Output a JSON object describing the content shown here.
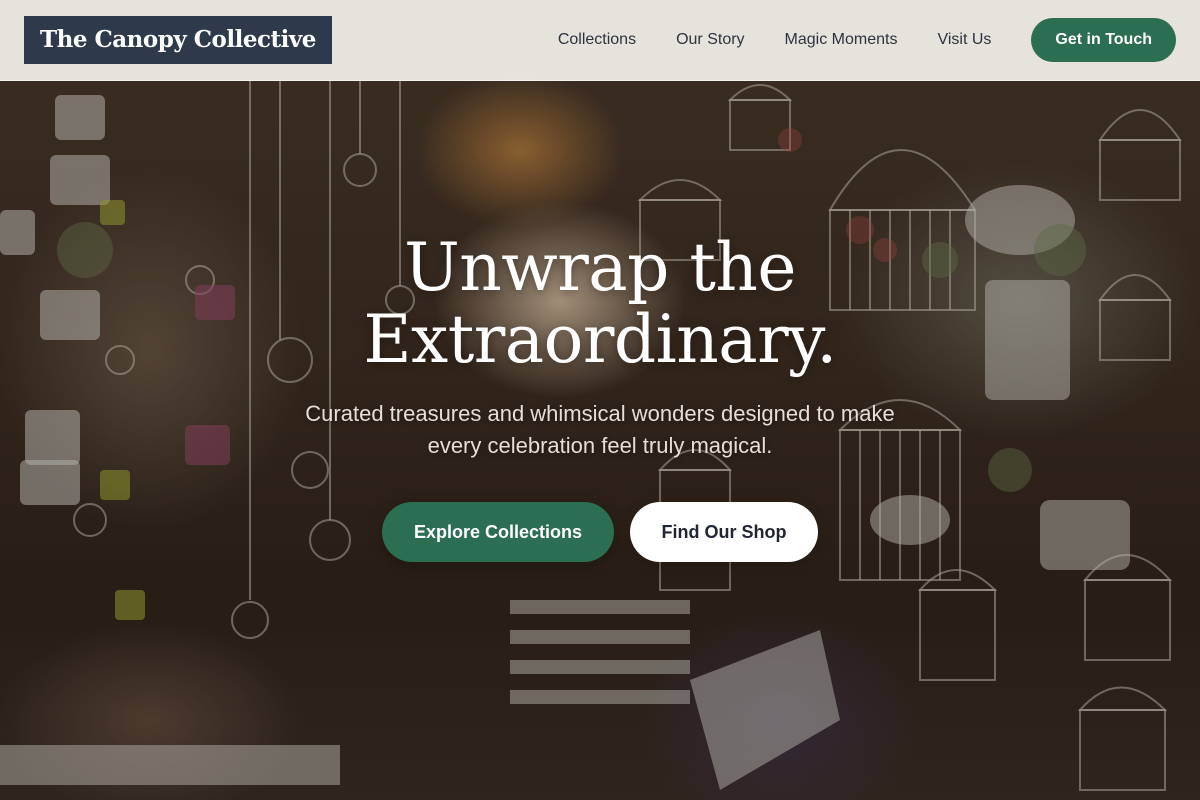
{
  "header": {
    "logo_text": "The Canopy Collective",
    "nav_items": [
      {
        "label": "Collections"
      },
      {
        "label": "Our Story"
      },
      {
        "label": "Magic Moments"
      },
      {
        "label": "Visit Us"
      }
    ],
    "cta_label": "Get in Touch"
  },
  "hero": {
    "title_line1": "Unwrap the",
    "title_line2": "Extraordinary.",
    "subtitle": "Curated treasures and whimsical wonders designed to make every celebration feel truly magical.",
    "primary_button": "Explore Collections",
    "secondary_button": "Find Our Shop",
    "background_description_icon": "shop-scene-image"
  },
  "colors": {
    "brand_green": "#2c6e52",
    "logo_navy": "#2e3a4b",
    "header_bg": "#f5f3ee",
    "nav_text": "#2d3340"
  }
}
